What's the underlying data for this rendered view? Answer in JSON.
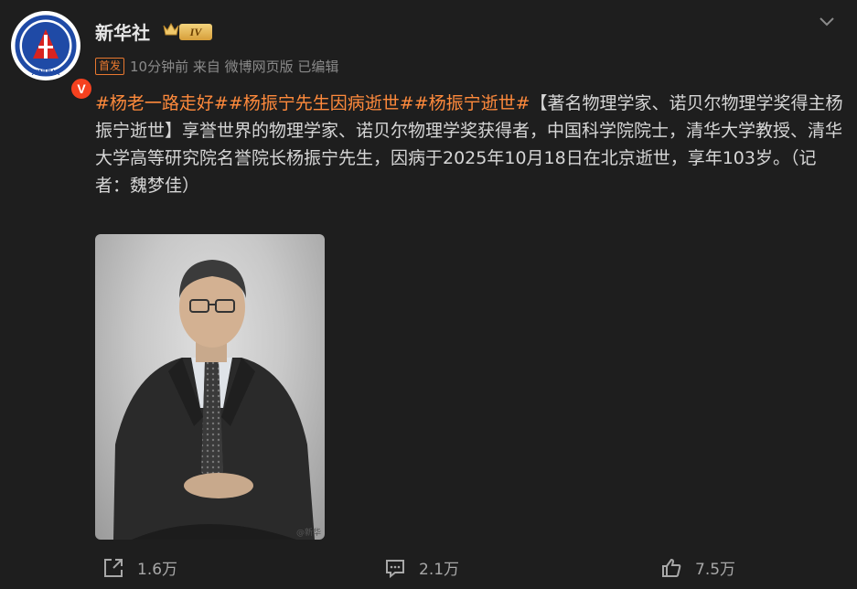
{
  "post": {
    "author": "新华社",
    "level_badge": "IV",
    "tag": "首发",
    "meta": "10分钟前 来自 微博网页版 已编辑",
    "hashtags": [
      "#杨老一路走好#",
      "#杨振宁先生因病逝世#",
      "#杨振宁逝世#"
    ],
    "body": "【著名物理学家、诺贝尔物理学奖得主杨振宁逝世】享誉世界的物理学家、诺贝尔物理学奖获得者，中国科学院院士，清华大学教授、清华大学高等研究院名誉院长杨振宁先生，因病于2025年10月18日在北京逝世，享年103岁。（记者：魏梦佳）",
    "avatar_text": "XINHUA",
    "verified_mark": "V",
    "watermark": "@新华"
  },
  "actions": {
    "share_count": "1.6万",
    "comment_count": "2.1万",
    "like_count": "7.5万"
  },
  "colors": {
    "accent": "#ff8a3c",
    "background": "#1e1e1e"
  }
}
